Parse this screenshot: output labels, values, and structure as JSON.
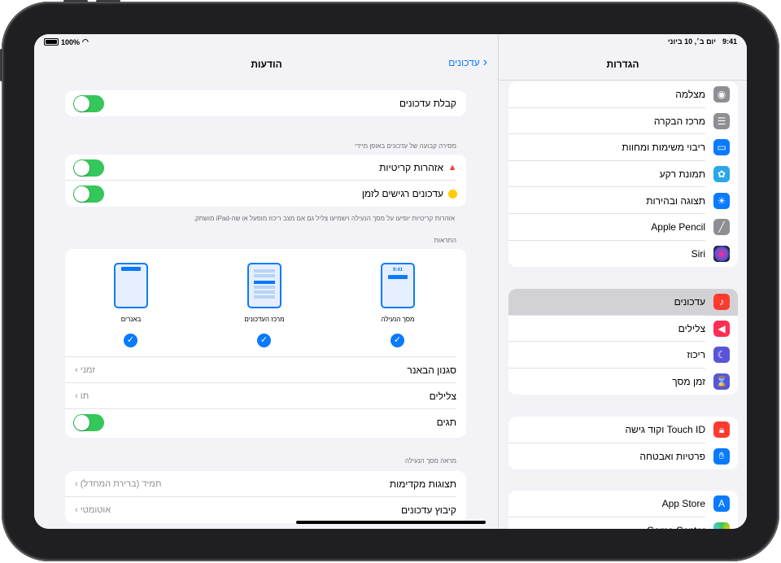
{
  "status": {
    "time": "9:41",
    "date": "יום ב׳, 10 ביוני",
    "battery": "100%"
  },
  "sidebar": {
    "title": "הגדרות",
    "groups": [
      [
        {
          "label": "מצלמה",
          "icon": "camera-icon",
          "color": "#8e8e93"
        },
        {
          "label": "מרכז הבקרה",
          "icon": "switches-icon",
          "color": "#8e8e93"
        },
        {
          "label": "ריבוי משימות ומחוות",
          "icon": "multitask-icon",
          "color": "#0a7aff"
        },
        {
          "label": "תמונת רקע",
          "icon": "wallpaper-icon",
          "color": "#2aa7e8"
        },
        {
          "label": "תצוגה ובהירות",
          "icon": "brightness-icon",
          "color": "#0a7aff"
        },
        {
          "label": "Apple Pencil",
          "icon": "pencil-icon",
          "color": "#8e8e93"
        },
        {
          "label": "Siri",
          "icon": "siri-icon",
          "color": "#222222"
        }
      ],
      [
        {
          "label": "עדכונים",
          "icon": "bell-icon",
          "color": "#ff3b30"
        },
        {
          "label": "צלילים",
          "icon": "speaker-icon",
          "color": "#ff2d55"
        },
        {
          "label": "ריכוז",
          "icon": "moon-icon",
          "color": "#5856d6"
        },
        {
          "label": "זמן מסך",
          "icon": "hourglass-icon",
          "color": "#5856d6"
        }
      ],
      [
        {
          "label": "Touch ID וקוד גישה",
          "icon": "fingerprint-icon",
          "color": "#ff3b30"
        },
        {
          "label": "פרטיות ואבטחה",
          "icon": "hand-icon",
          "color": "#0a7aff"
        }
      ],
      [
        {
          "label": "App Store",
          "icon": "appstore-icon",
          "color": "#0a7aff"
        },
        {
          "label": "Game Center",
          "icon": "gamecenter-icon",
          "color": "#34c759"
        }
      ]
    ]
  },
  "main": {
    "title": "הודעות",
    "back_label": "עדכונים",
    "allow": "קבלת עדכונים",
    "immediate_header": "מסירה קבועה של עדכונים באופן מיידי",
    "critical": "אזהרות קריטיות",
    "time_sensitive": "עדכונים רגישים לזמן",
    "immediate_footer": "אזהרות קריטיות יופיעו על מסך הנעילה וישמיעו צליל גם אם מצב ריכוז מופעל או שה-iPad מושתק.",
    "alerts_header": "התראות",
    "phones": [
      {
        "label": "מסך הנעילה",
        "time": "9:41"
      },
      {
        "label": "מרכז העדכונים"
      },
      {
        "label": "באנרים"
      }
    ],
    "banner_style": "סגנון הבאנר",
    "banner_style_value": "זמני",
    "sounds": "צלילים",
    "sounds_value": "תו",
    "badges": "תגים",
    "lock_header": "מראה מסך הנעילה",
    "previews": "תצוגות מקדימות",
    "previews_value": "תמיד (ברירת המחדל)",
    "grouping": "קיבוץ עדכונים",
    "grouping_value": "אוטומטי"
  }
}
